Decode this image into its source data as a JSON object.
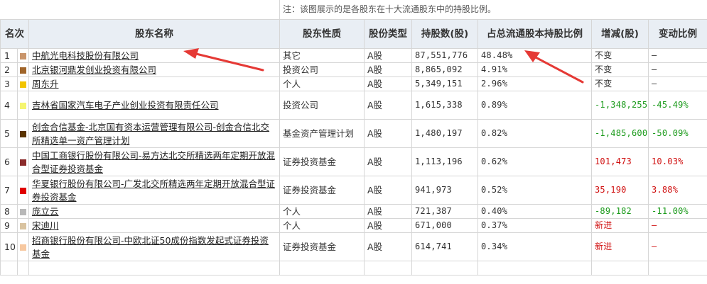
{
  "note": "注：该图展示的是各股东在十大流通股东中的持股比例。",
  "headers": {
    "rank": "名次",
    "name": "股东名称",
    "nature": "股东性质",
    "share_type": "股份类型",
    "shares": "持股数(股)",
    "ratio": "占总流通股本持股比例",
    "change": "增减(股)",
    "change_ratio": "变动比例"
  },
  "rows": [
    {
      "rank": "1",
      "color": "#c9956b",
      "name": "中航光电科技股份有限公司",
      "nature": "其它",
      "share_type": "A股",
      "shares": "87,551,776",
      "ratio": "48.48%",
      "change": "不变",
      "change_ratio": "—",
      "tone": ""
    },
    {
      "rank": "2",
      "color": "#a0652a",
      "name": "北京银河鼎发创业投资有限公司",
      "nature": "投资公司",
      "share_type": "A股",
      "shares": "8,865,092",
      "ratio": "4.91%",
      "change": "不变",
      "change_ratio": "—",
      "tone": ""
    },
    {
      "rank": "3",
      "color": "#f2c400",
      "name": "周东升",
      "nature": "个人",
      "share_type": "A股",
      "shares": "5,349,151",
      "ratio": "2.96%",
      "change": "不变",
      "change_ratio": "—",
      "tone": ""
    },
    {
      "rank": "4",
      "color": "#f5f570",
      "name": "吉林省国家汽车电子产业创业投资有限责任公司",
      "nature": "投资公司",
      "share_type": "A股",
      "shares": "1,615,338",
      "ratio": "0.89%",
      "change": "-1,348,255",
      "change_ratio": "-45.49%",
      "tone": "green"
    },
    {
      "rank": "5",
      "color": "#5a3300",
      "name": "创金合信基金-北京国有资本运营管理有限公司-创金合信北交所精选单一资产管理计划",
      "nature": "基金资产管理计划",
      "share_type": "A股",
      "shares": "1,480,197",
      "ratio": "0.82%",
      "change": "-1,485,600",
      "change_ratio": "-50.09%",
      "tone": "green"
    },
    {
      "rank": "6",
      "color": "#8b2c2c",
      "name": "中国工商银行股份有限公司-易方达北交所精选两年定期开放混合型证券投资基金",
      "nature": "证券投资基金",
      "share_type": "A股",
      "shares": "1,113,196",
      "ratio": "0.62%",
      "change": "101,473",
      "change_ratio": "10.03%",
      "tone": "red"
    },
    {
      "rank": "7",
      "color": "#e00000",
      "name": "华夏银行股份有限公司-广发北交所精选两年定期开放混合型证券投资基金",
      "nature": "证券投资基金",
      "share_type": "A股",
      "shares": "941,973",
      "ratio": "0.52%",
      "change": "35,190",
      "change_ratio": "3.88%",
      "tone": "red"
    },
    {
      "rank": "8",
      "color": "#b8b8b8",
      "name": "庞立云",
      "nature": "个人",
      "share_type": "A股",
      "shares": "721,387",
      "ratio": "0.40%",
      "change": "-89,182",
      "change_ratio": "-11.00%",
      "tone": "green"
    },
    {
      "rank": "9",
      "color": "#d9c3a0",
      "name": "宋迪川",
      "nature": "个人",
      "share_type": "A股",
      "shares": "671,000",
      "ratio": "0.37%",
      "change": "新进",
      "change_ratio": "—",
      "tone": "red"
    },
    {
      "rank": "10",
      "color": "#f7c8a0",
      "name": "招商银行股份有限公司-中欧北证50成份指数发起式证券投资基金",
      "nature": "证券投资基金",
      "share_type": "A股",
      "shares": "614,741",
      "ratio": "0.34%",
      "change": "新进",
      "change_ratio": "—",
      "tone": "red"
    }
  ],
  "colors": {
    "header_bg": "#e9eef4",
    "decrease": "#1a9a1a",
    "increase": "#d01010",
    "annotation_arrow": "#e53935"
  }
}
